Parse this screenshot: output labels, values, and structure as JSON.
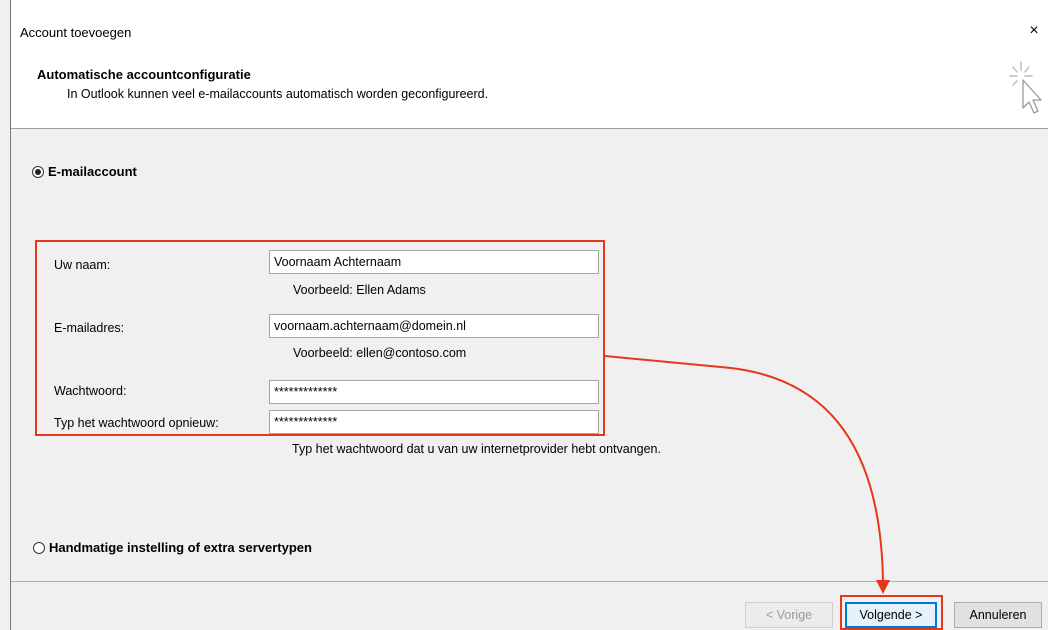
{
  "window": {
    "title": "Account toevoegen",
    "close_glyph": "×"
  },
  "header": {
    "title": "Automatische accountconfiguratie",
    "subtitle": "In Outlook kunnen veel e-mailaccounts automatisch worden geconfigureerd.",
    "icon": "wizard-sparkle-cursor-icon"
  },
  "options": {
    "email_account": {
      "label": "E-mailaccount",
      "checked": true
    },
    "manual_setup": {
      "label": "Handmatige instelling of extra servertypen",
      "checked": false
    }
  },
  "form": {
    "name": {
      "label": "Uw naam:",
      "value": "Voornaam Achternaam",
      "example": "Voorbeeld: Ellen Adams"
    },
    "email": {
      "label": "E-mailadres:",
      "value": "voornaam.achternaam@domein.nl",
      "example": "Voorbeeld: ellen@contoso.com"
    },
    "password": {
      "label": "Wachtwoord:",
      "value": "*************"
    },
    "password_repeat": {
      "label": "Typ het wachtwoord opnieuw:",
      "value": "*************"
    },
    "password_hint": "Typ het wachtwoord dat u van uw internetprovider hebt ontvangen."
  },
  "buttons": {
    "back": "< Vorige",
    "next": "Volgende >",
    "cancel": "Annuleren"
  },
  "colors": {
    "annotation": "#e4381d",
    "focus": "#0078d7"
  }
}
